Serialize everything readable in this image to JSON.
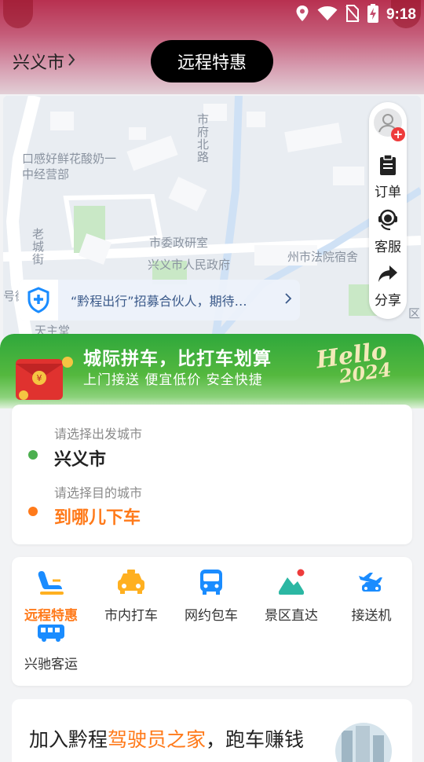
{
  "status_bar": {
    "time": "9:18"
  },
  "header": {
    "city": "兴义市",
    "promo_tab": "远程特惠"
  },
  "map": {
    "labels": {
      "shop": "口感好鲜花酸奶一中经营部",
      "road_north": "市府北路",
      "street_old": "老城街",
      "research": "市委政研室",
      "government": "兴义市人民政府",
      "court": "州市法院宿舍",
      "edge_left": "号街",
      "tiantang": "天主堂",
      "edge_right": "区"
    },
    "notice": "“黔程出行”招募合伙人，期待…",
    "side_panel": {
      "order": "订单",
      "service": "客服",
      "share": "分享"
    }
  },
  "banner": {
    "title": "城际拼车，比打车划算",
    "subtitle": "上门接送  便宜低价  安全快捷",
    "hello": "Hello",
    "year": "2024"
  },
  "route": {
    "from_hint": "请选择出发城市",
    "from_city": "兴义市",
    "to_hint": "请选择目的城市",
    "to_city": "到哪儿下车",
    "from_color": "#4caf50",
    "to_color": "#ff7a1a"
  },
  "services": [
    {
      "label": "远程特惠",
      "icon": "seat-icon",
      "active": true
    },
    {
      "label": "市内打车",
      "icon": "taxi-icon",
      "active": false
    },
    {
      "label": "网约包车",
      "icon": "bus-icon",
      "active": false
    },
    {
      "label": "景区直达",
      "icon": "mountain-icon",
      "active": false
    },
    {
      "label": "接送机",
      "icon": "airplane-icon",
      "active": false
    },
    {
      "label": "兴驰客运",
      "icon": "coach-icon",
      "active": false
    }
  ],
  "driver_promo": {
    "prefix": "加入黔程",
    "highlight": "驾驶员之家",
    "suffix": "，跑车赚钱"
  },
  "colors": {
    "accent": "#ff7a1a",
    "green": "#3dae3a",
    "blue": "#1a8cff",
    "teal": "#2bb7a3"
  }
}
